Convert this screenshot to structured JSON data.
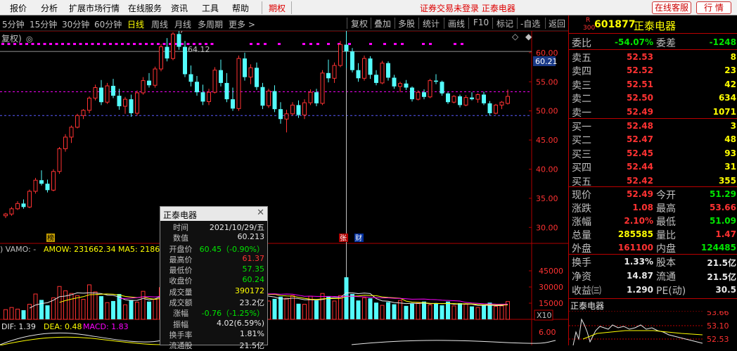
{
  "menubar": {
    "items": [
      "报价",
      "分析",
      "扩展市场行情",
      "在线服务",
      "资讯",
      "工具",
      "帮助"
    ],
    "futures": "期权",
    "status": "证券交易未登录  正泰电器",
    "service_button": "在线客服",
    "quote_button": "行 情"
  },
  "periods": [
    "5分钟",
    "15分钟",
    "30分钟",
    "60分钟",
    "日线",
    "周线",
    "月线",
    "多周期",
    "更多 >"
  ],
  "active_period": "日线",
  "tools": [
    "复权",
    "叠加",
    "多股",
    "统计",
    "画线",
    "F10",
    "标记",
    "-自选",
    "返回"
  ],
  "chart_labels": {
    "fq": "复权)",
    "price_now": "60.21",
    "peak": "64.12",
    "marker_bang": "榜",
    "marker_zhang": "张",
    "marker_cai": "财",
    "vol_header_name": ") VAMO: -",
    "vol_header_amow": "AMOW: 231662.34",
    "vol_header_ma5": "MA5: 2186",
    "macd_dif": "DIF: 1.39",
    "macd_dea": "DEA: 0.48",
    "macd_val": "MACD: 1.83",
    "x10": "X10"
  },
  "chart_data": {
    "type": "candlestick",
    "price_axis": {
      "ticks": [
        60,
        55,
        50,
        45,
        40,
        35,
        30
      ],
      "tick_labels": [
        "60.00",
        "55.00",
        "50.00",
        "45.00",
        "40.00",
        "35.00",
        "30.00"
      ],
      "range": [
        27.5,
        63.0
      ]
    },
    "volume_axis": {
      "ticks": [
        45000,
        30000,
        15000
      ],
      "tick_labels": [
        "45000",
        "30000",
        "15000"
      ],
      "range": [
        0,
        60000
      ]
    },
    "macd_axis": {
      "tick_labels": [
        "6.00"
      ]
    },
    "reference_lines": [
      60.21,
      53.3,
      49.2
    ],
    "candles": [
      [
        32.0,
        32.5,
        31.6,
        32.3
      ],
      [
        32.3,
        33.5,
        32.0,
        33.2
      ],
      [
        33.2,
        34.5,
        33.0,
        34.1
      ],
      [
        34.1,
        34.8,
        33.2,
        33.5
      ],
      [
        33.5,
        36.5,
        33.3,
        36.2
      ],
      [
        36.2,
        38.5,
        35.8,
        38.1
      ],
      [
        38.1,
        39.8,
        37.2,
        37.5
      ],
      [
        37.5,
        38.2,
        36.0,
        36.4
      ],
      [
        36.4,
        40.0,
        36.2,
        39.6
      ],
      [
        39.6,
        43.8,
        39.2,
        43.5
      ],
      [
        43.5,
        46.0,
        43.0,
        45.5
      ],
      [
        45.5,
        47.5,
        44.5,
        47.2
      ],
      [
        47.2,
        49.5,
        47.0,
        49.2
      ],
      [
        49.2,
        50.3,
        48.6,
        50.1
      ],
      [
        50.1,
        52.5,
        49.6,
        52.2
      ],
      [
        52.2,
        54.5,
        51.8,
        54.0
      ],
      [
        54.0,
        55.3,
        51.0,
        51.5
      ],
      [
        51.5,
        54.8,
        51.2,
        54.3
      ],
      [
        54.3,
        55.5,
        52.2,
        52.6
      ],
      [
        52.6,
        53.8,
        50.2,
        50.8
      ],
      [
        50.8,
        52.4,
        49.5,
        52.0
      ],
      [
        52.0,
        52.8,
        49.0,
        49.6
      ],
      [
        49.6,
        53.5,
        49.2,
        53.1
      ],
      [
        53.1,
        55.8,
        52.8,
        55.2
      ],
      [
        55.2,
        56.5,
        54.0,
        54.4
      ],
      [
        54.4,
        57.6,
        54.0,
        57.2
      ],
      [
        57.2,
        61.5,
        56.8,
        61.0
      ],
      [
        61.0,
        62.5,
        58.5,
        59.0
      ],
      [
        59.0,
        63.5,
        58.7,
        63.2
      ],
      [
        63.2,
        64.12,
        60.5,
        61.0
      ],
      [
        61.0,
        62.0,
        55.8,
        56.3
      ],
      [
        56.3,
        57.8,
        54.2,
        55.0
      ],
      [
        55.0,
        56.0,
        52.6,
        53.2
      ],
      [
        53.2,
        54.5,
        51.0,
        51.6
      ],
      [
        51.6,
        53.8,
        51.0,
        53.2
      ],
      [
        53.2,
        57.5,
        53.0,
        57.0
      ],
      [
        57.0,
        58.8,
        54.2,
        54.8
      ],
      [
        54.8,
        56.5,
        51.5,
        52.0
      ],
      [
        52.0,
        54.0,
        50.0,
        50.4
      ],
      [
        50.4,
        59.5,
        50.0,
        59.0
      ],
      [
        59.0,
        60.0,
        55.2,
        55.8
      ],
      [
        55.8,
        58.0,
        54.6,
        57.4
      ],
      [
        57.4,
        58.3,
        53.6,
        54.1
      ],
      [
        54.1,
        54.8,
        50.3,
        50.9
      ],
      [
        50.9,
        53.8,
        50.5,
        53.4
      ],
      [
        53.4,
        54.4,
        49.8,
        50.3
      ],
      [
        50.3,
        51.5,
        47.8,
        48.6
      ],
      [
        48.6,
        50.2,
        46.3,
        49.5
      ],
      [
        49.5,
        51.5,
        49.2,
        51.0
      ],
      [
        51.0,
        51.8,
        48.8,
        49.3
      ],
      [
        49.3,
        52.0,
        48.6,
        51.4
      ],
      [
        51.4,
        53.7,
        51.0,
        53.2
      ],
      [
        53.2,
        53.8,
        50.8,
        51.3
      ],
      [
        51.3,
        57.0,
        51.0,
        56.5
      ],
      [
        56.5,
        58.8,
        54.9,
        55.6
      ],
      [
        55.6,
        58.3,
        54.8,
        57.8
      ],
      [
        57.8,
        62.0,
        57.5,
        61.4
      ],
      [
        61.37,
        64.12,
        57.35,
        60.24
      ],
      [
        60.2,
        60.8,
        56.6,
        57.0
      ],
      [
        57.0,
        58.2,
        55.0,
        55.6
      ],
      [
        55.6,
        59.5,
        55.2,
        59.0
      ],
      [
        59.0,
        59.4,
        55.5,
        56.2
      ],
      [
        56.2,
        57.0,
        54.4,
        54.8
      ],
      [
        54.8,
        58.6,
        54.6,
        58.2
      ],
      [
        58.2,
        58.5,
        55.2,
        55.7
      ],
      [
        55.7,
        56.2,
        53.8,
        54.2
      ],
      [
        54.2,
        55.0,
        53.2,
        54.7
      ],
      [
        54.7,
        55.3,
        53.6,
        54.0
      ],
      [
        54.0,
        54.2,
        51.6,
        52.0
      ],
      [
        52.0,
        53.5,
        51.8,
        53.2
      ],
      [
        53.2,
        53.7,
        52.0,
        52.4
      ],
      [
        52.4,
        55.5,
        52.2,
        55.2
      ],
      [
        55.2,
        56.3,
        54.6,
        55.0
      ],
      [
        55.0,
        55.2,
        52.6,
        53.0
      ],
      [
        53.0,
        53.2,
        51.2,
        51.5
      ],
      [
        51.5,
        52.7,
        51.3,
        52.5
      ],
      [
        52.5,
        52.8,
        50.6,
        51.0
      ],
      [
        51.0,
        52.7,
        50.8,
        52.3
      ],
      [
        52.3,
        53.2,
        51.8,
        52.0
      ],
      [
        52.0,
        53.0,
        51.4,
        52.8
      ],
      [
        52.8,
        53.3,
        51.0,
        51.3
      ],
      [
        51.3,
        51.7,
        49.2,
        49.6
      ],
      [
        49.6,
        51.2,
        49.4,
        51.0
      ],
      [
        51.0,
        51.7,
        50.3,
        51.5
      ],
      [
        51.29,
        53.66,
        51.09,
        52.49
      ]
    ],
    "volume": [
      9000,
      11000,
      9500,
      8500,
      14000,
      23500,
      18000,
      13000,
      20000,
      30500,
      26500,
      24000,
      22000,
      18500,
      32000,
      25500,
      21500,
      15500,
      17000,
      23500,
      13500,
      18000,
      16000,
      26000,
      16500,
      18500,
      29500,
      14000,
      25000,
      33500,
      34500,
      18500,
      21500,
      26000,
      20000,
      18000,
      32500,
      23000,
      23500,
      26500,
      23000,
      29000,
      20500,
      18000,
      17000,
      19000,
      21000,
      19500,
      22000,
      14500,
      14000,
      21500,
      17500,
      24000,
      21000,
      17000,
      22000,
      39017,
      23500,
      17500,
      20000,
      19500,
      15500,
      13000,
      16000,
      14000,
      17500,
      12500,
      14500,
      15000,
      16500,
      13500,
      14500,
      13000,
      16500,
      12500,
      15000,
      14000,
      12000,
      11000,
      13000,
      15500,
      12000,
      12500,
      16500
    ],
    "highlight_index": 57
  },
  "quote": {
    "code": "601877",
    "name": "正泰电器",
    "corner_top": "R",
    "corner_bottom": "300",
    "committee_ratio_label": "委比",
    "committee_ratio": "-54.07%",
    "committee_diff_label": "委差",
    "committee_diff": "-1248",
    "asks": [
      {
        "label": "卖五",
        "price": "52.53",
        "vol": "8"
      },
      {
        "label": "卖四",
        "price": "52.52",
        "vol": "23"
      },
      {
        "label": "卖三",
        "price": "52.51",
        "vol": "42"
      },
      {
        "label": "卖二",
        "price": "52.50",
        "vol": "634"
      },
      {
        "label": "卖一",
        "price": "52.49",
        "vol": "1071"
      }
    ],
    "bids": [
      {
        "label": "买一",
        "price": "52.48",
        "vol": "3"
      },
      {
        "label": "买二",
        "price": "52.47",
        "vol": "48"
      },
      {
        "label": "买三",
        "price": "52.45",
        "vol": "93"
      },
      {
        "label": "买四",
        "price": "52.44",
        "vol": "31"
      },
      {
        "label": "买五",
        "price": "52.42",
        "vol": "355"
      }
    ],
    "stats": [
      {
        "l1": "现价",
        "v1": "52.49",
        "c1": "red",
        "l2": "今开",
        "v2": "51.29",
        "c2": "green"
      },
      {
        "l1": "涨跌",
        "v1": "1.08",
        "c1": "red",
        "l2": "最高",
        "v2": "53.66",
        "c2": "red"
      },
      {
        "l1": "涨幅",
        "v1": "2.10%",
        "c1": "red",
        "l2": "最低",
        "v2": "51.09",
        "c2": "green"
      },
      {
        "l1": "总量",
        "v1": "285585",
        "c1": "yellow",
        "l2": "量比",
        "v2": "1.47",
        "c2": "red"
      },
      {
        "l1": "外盘",
        "v1": "161100",
        "c1": "red",
        "l2": "内盘",
        "v2": "124485",
        "c2": "green"
      }
    ],
    "stats2": [
      {
        "l1": "换手",
        "v1": "1.33%",
        "l2": "股本",
        "v2": "21.5亿"
      },
      {
        "l1": "净资",
        "v1": "14.87",
        "l2": "流通",
        "v2": "21.5亿"
      },
      {
        "l1": "收益㈢",
        "v1": "1.290",
        "l2": "PE(动)",
        "v2": "30.5"
      }
    ],
    "mini_title": "正泰电器",
    "mini_ticks": [
      "53.66",
      "53.10",
      "52.53"
    ]
  },
  "popup": {
    "title": "正泰电器",
    "close": "✕",
    "rows": [
      {
        "label": "时间",
        "value": "2021/10/29/五",
        "color": "white"
      },
      {
        "label": "数值",
        "value": "60.213",
        "color": "white"
      },
      {
        "label": "开盘价",
        "value": "60.45（-0.90%）",
        "color": "green"
      },
      {
        "label": "最高价",
        "value": "61.37",
        "color": "red"
      },
      {
        "label": "最低价",
        "value": "57.35",
        "color": "green"
      },
      {
        "label": "收盘价",
        "value": "60.24",
        "color": "green"
      },
      {
        "label": "成交量",
        "value": "390172",
        "color": "yellow"
      },
      {
        "label": "成交额",
        "value": "23.2亿",
        "color": "white"
      },
      {
        "label": "涨幅",
        "value": "-0.76（-1.25%）",
        "color": "green"
      },
      {
        "label": "振幅",
        "value": "4.02(6.59%)",
        "color": "white"
      },
      {
        "label": "换手率",
        "value": "1.81%",
        "color": "white"
      },
      {
        "label": "流通股",
        "value": "21.5亿",
        "color": "white"
      }
    ]
  },
  "colors": {
    "up": "#ff3232",
    "down": "#54fcfc",
    "bg": "#000000",
    "grid": "#b00000",
    "ma5": "#ffffff",
    "ma10": "#ffff00",
    "ma20": "#ff00ff"
  }
}
